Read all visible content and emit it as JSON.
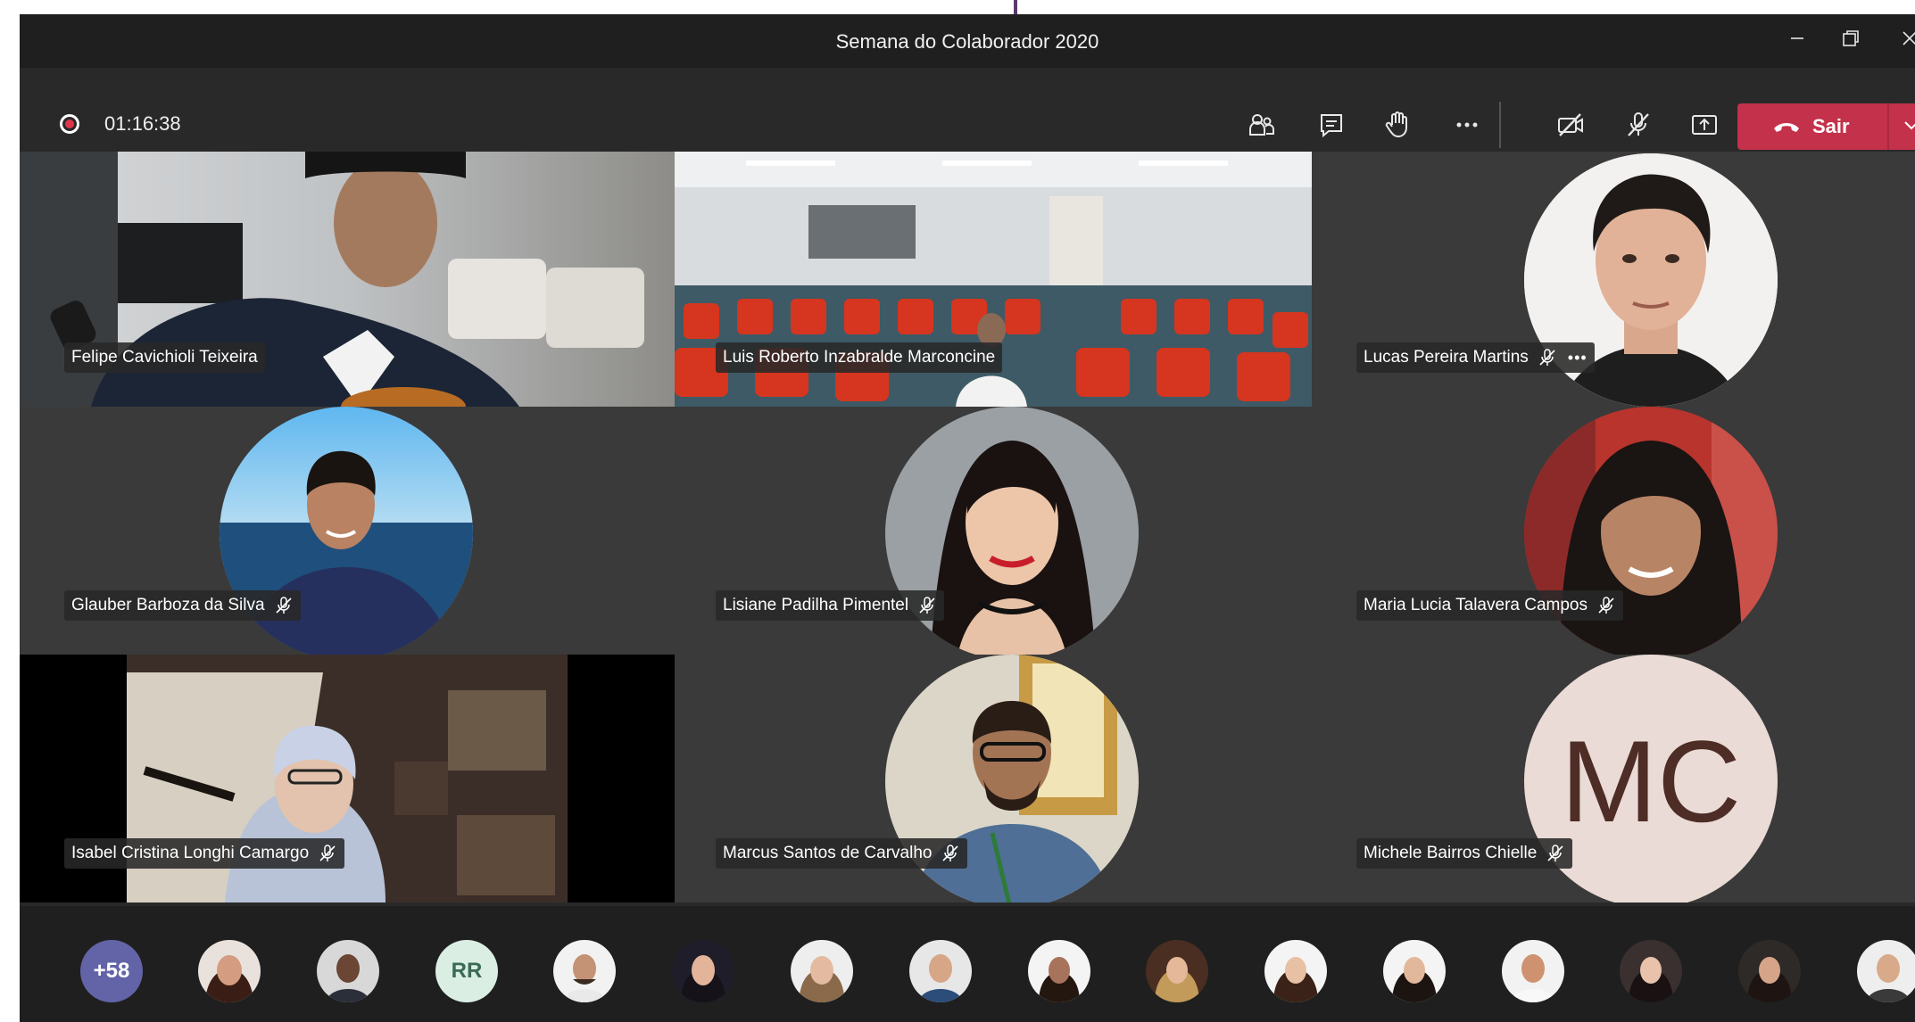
{
  "window": {
    "title": "Semana do Colaborador 2020",
    "controls": [
      "minimize-icon",
      "restore-icon",
      "close-icon"
    ]
  },
  "toolbar": {
    "timer": "01:16:38",
    "icons": [
      "people-icon",
      "chat-icon",
      "raise-hand-icon",
      "more-icon",
      "camera-off-icon",
      "mic-off-icon",
      "share-screen-icon"
    ],
    "leave_label": "Sair"
  },
  "participants": [
    {
      "name": "Felipe Cavichioli Teixeira",
      "muted": false,
      "video": true
    },
    {
      "name": "Luis Roberto Inzabralde Marconcine",
      "muted": false,
      "video": true
    },
    {
      "name": "Lucas Pereira Martins",
      "muted": true,
      "more": "•••",
      "video": false
    },
    {
      "name": "Glauber Barboza da Silva",
      "muted": true,
      "video": false
    },
    {
      "name": "Lisiane Padilha Pimentel",
      "muted": true,
      "video": false
    },
    {
      "name": "Maria Lucia Talavera Campos",
      "muted": true,
      "video": false
    },
    {
      "name": "Isabel Cristina Longhi Camargo",
      "muted": true,
      "video": true
    },
    {
      "name": "Marcus Santos de Carvalho",
      "muted": true,
      "video": false
    },
    {
      "name": "Michele Bairros Chielle",
      "muted": true,
      "initials": "MC",
      "video": false
    }
  ],
  "roster": {
    "overflow_count": "+58",
    "initials_avatar": "RR"
  },
  "colors": {
    "accent_leave": "#c4314b",
    "background": "#292929",
    "overflow_badge": "#6264a7"
  }
}
